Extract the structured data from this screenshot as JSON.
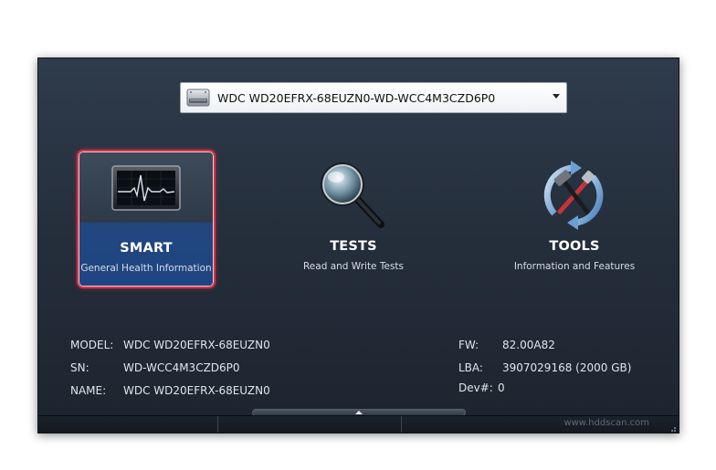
{
  "drive_selector": {
    "selected": "WDC WD20EFRX-68EUZN0-WD-WCC4M3CZD6P0",
    "icon": "hard-drive-icon"
  },
  "tiles": [
    {
      "title": "SMART",
      "subtitle": "General Health Information",
      "icon": "monitor-heartbeat-icon",
      "selected": true
    },
    {
      "title": "TESTS",
      "subtitle": "Read and Write Tests",
      "icon": "magnifier-icon",
      "selected": false
    },
    {
      "title": "TOOLS",
      "subtitle": "Information and Features",
      "icon": "tools-refresh-icon",
      "selected": false
    }
  ],
  "info": {
    "model_label": "MODEL:",
    "model_value": "WDC WD20EFRX-68EUZN0",
    "sn_label": "SN:",
    "sn_value": "WD-WCC4M3CZD6P0",
    "name_label": "NAME:",
    "name_value": "WDC WD20EFRX-68EUZN0",
    "fw_label": "FW:",
    "fw_value": "82.00A82",
    "lba_label": "LBA:",
    "lba_value": "3907029168 (2000 GB)",
    "dev_label": "Dev#:",
    "dev_value": "0"
  },
  "footer": {
    "link": "www.hddscan.com"
  },
  "colors": {
    "accent_selected_border": "#d8334a",
    "selected_tile_bottom": "#1f4583"
  }
}
